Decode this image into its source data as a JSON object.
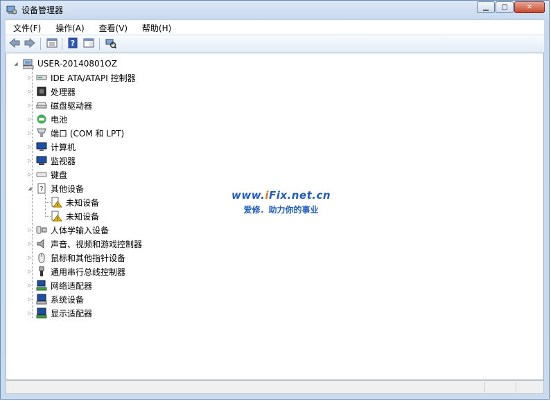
{
  "window": {
    "title": "设备管理器",
    "minimize_glyph": "▁",
    "maximize_glyph": "▢",
    "close_glyph": "✕"
  },
  "menu": [
    {
      "label": "文件(F)"
    },
    {
      "label": "操作(A)"
    },
    {
      "label": "查看(V)"
    },
    {
      "label": "帮助(H)"
    }
  ],
  "toolbar": {
    "icons": [
      "back-arrow-icon",
      "forward-arrow-icon",
      "properties-icon",
      "help-icon",
      "panel-icon",
      "scan-hardware-icon"
    ]
  },
  "tree": {
    "root": "USER-20140801OZ",
    "items": [
      {
        "label": "IDE ATA/ATAPI 控制器",
        "icon": "ide-controller-icon"
      },
      {
        "label": "处理器",
        "icon": "processor-icon"
      },
      {
        "label": "磁盘驱动器",
        "icon": "disk-drive-icon"
      },
      {
        "label": "电池",
        "icon": "battery-icon"
      },
      {
        "label": "端口 (COM 和 LPT)",
        "icon": "port-icon"
      },
      {
        "label": "计算机",
        "icon": "computer-icon"
      },
      {
        "label": "监视器",
        "icon": "monitor-icon"
      },
      {
        "label": "键盘",
        "icon": "keyboard-icon"
      },
      {
        "label": "其他设备",
        "icon": "other-devices-icon",
        "expanded": true,
        "children": [
          {
            "label": "未知设备",
            "icon": "unknown-device-warning-icon"
          },
          {
            "label": "未知设备",
            "icon": "unknown-device-warning-icon"
          }
        ]
      },
      {
        "label": "人体学输入设备",
        "icon": "hid-icon"
      },
      {
        "label": "声音、视频和游戏控制器",
        "icon": "sound-icon"
      },
      {
        "label": "鼠标和其他指针设备",
        "icon": "mouse-icon"
      },
      {
        "label": "通用串行总线控制器",
        "icon": "usb-icon"
      },
      {
        "label": "网络适配器",
        "icon": "network-adapter-icon"
      },
      {
        "label": "系统设备",
        "icon": "system-device-icon"
      },
      {
        "label": "显示适配器",
        "icon": "display-adapter-icon"
      }
    ]
  },
  "watermark": {
    "line1_prefix": "www.",
    "line1_i": "i",
    "line1_suffix": "Fix.net.cn",
    "line2": "爱修．助力你的事业"
  },
  "colors": {
    "accent": "#1f5dbe",
    "watermark_i": "#e07a10",
    "warning": "#f2c200"
  }
}
